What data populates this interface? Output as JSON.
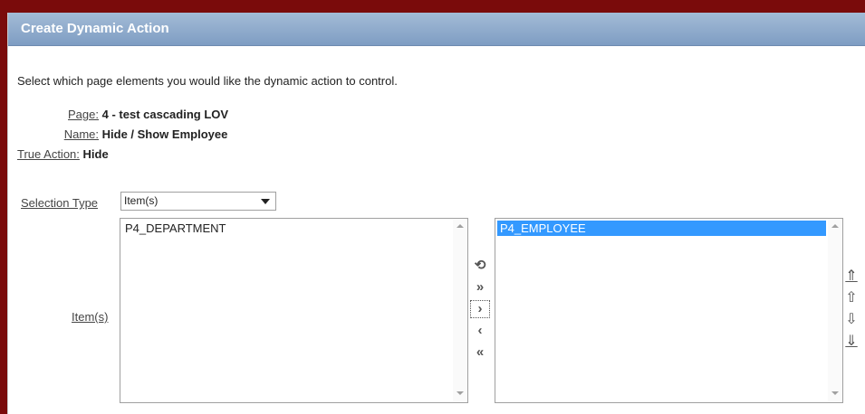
{
  "header": {
    "title": "Create Dynamic Action"
  },
  "instructions": "Select which page elements you would like the dynamic action to control.",
  "info": {
    "page_label": "Page:",
    "page_value": "4 - test cascading LOV",
    "name_label": "Name:",
    "name_value": "Hide / Show Employee",
    "true_action_label": "True Action:",
    "true_action_value": "Hide"
  },
  "selection_type": {
    "label": "Selection Type",
    "value": "Item(s)"
  },
  "items": {
    "label": "Item(s)",
    "available": [
      "P4_DEPARTMENT"
    ],
    "selected": [
      "P4_EMPLOYEE"
    ]
  },
  "icons": {
    "reset": "reset-icon",
    "move_all": "move-all-icon",
    "move": "move-icon",
    "remove": "remove-icon",
    "remove_all": "remove-all-icon",
    "top": "move-top-icon",
    "up": "move-up-icon",
    "down": "move-down-icon",
    "bottom": "move-bottom-icon"
  },
  "colors": {
    "background": "#7a0b0b",
    "header": "#8ea9cc",
    "selection": "#3399ff"
  }
}
